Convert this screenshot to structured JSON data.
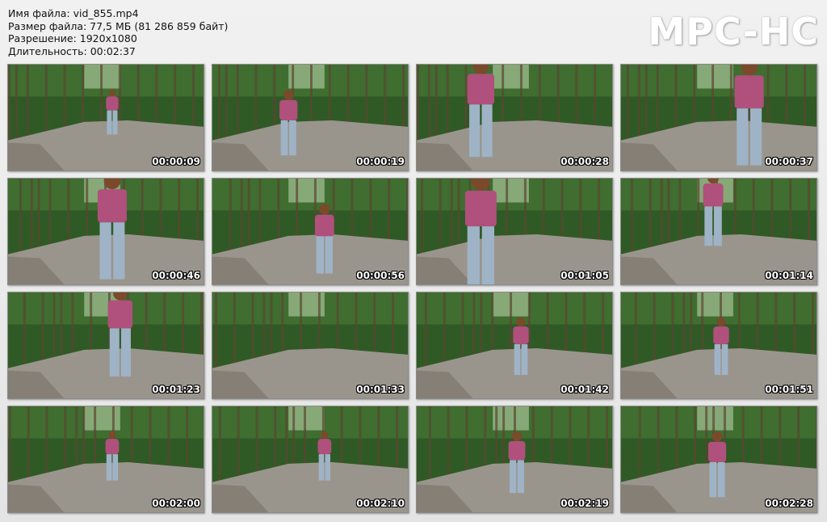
{
  "file_info": {
    "name": "Имя файла: vid_855.mp4",
    "size": "Размер файла: 77,5 МБ (81 286 859 байт)",
    "resolution": "Разрешение: 1920x1080",
    "duration": "Длительность: 00:02:37"
  },
  "logo": "MPC-HC",
  "thumbnails": [
    {
      "time": "00:00:09"
    },
    {
      "time": "00:00:19"
    },
    {
      "time": "00:00:28"
    },
    {
      "time": "00:00:37"
    },
    {
      "time": "00:00:46"
    },
    {
      "time": "00:00:56"
    },
    {
      "time": "00:01:05"
    },
    {
      "time": "00:01:14"
    },
    {
      "time": "00:01:23"
    },
    {
      "time": "00:01:33"
    },
    {
      "time": "00:01:42"
    },
    {
      "time": "00:01:51"
    },
    {
      "time": "00:02:00"
    },
    {
      "time": "00:02:10"
    },
    {
      "time": "00:02:19"
    },
    {
      "time": "00:02:28"
    }
  ],
  "colors": {
    "forest": "#2f5a26",
    "road": "#9a958c",
    "shirt": "#b0507c",
    "jeans": "#9fb3c6"
  }
}
